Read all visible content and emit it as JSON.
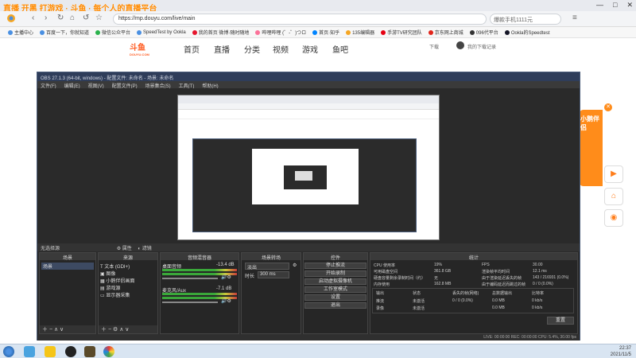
{
  "browser": {
    "tab_title": "直播 开黑 打游戏 · 斗鱼 · 每个人的直播平台",
    "address": "https://mp.douyu.com/live/main",
    "search_placeholder": "爆款手机1111元",
    "bookmarks": [
      "主播中心",
      "百度一下，你就知道",
      "微信公众平台",
      "SpeedTest by Ookla",
      "我的首页 微博·随时随地",
      "哔哩哔哩 (゜-゜)つロ",
      "首页·知乎",
      "135编辑器",
      "手游TV研究团队",
      "京东网上商城",
      "096代平台",
      "Ookla的Speedtest"
    ],
    "window_controls": [
      "—",
      "□",
      "✕"
    ]
  },
  "douyu": {
    "logo": "斗鱼",
    "logo_sub": "DOUYU.COM",
    "nav": [
      "首页",
      "直播",
      "分类",
      "视频",
      "游戏",
      "鱼吧"
    ],
    "download": "下载",
    "user": "我的下载记录"
  },
  "obs": {
    "title": "OBS 27.1.3 (64-bit, windows) - 配置文件: 未命名 - 场景: 未命名",
    "menu": [
      "文件(F)",
      "编辑(E)",
      "视图(V)",
      "配置文件(P)",
      "场景集合(S)",
      "工具(T)",
      "帮助(H)"
    ],
    "source_bar": "无选择源",
    "properties": "属性",
    "filters": "滤镜",
    "docks": {
      "scenes": "场景",
      "sources": "来源",
      "mixer": "音频混音器",
      "transitions": "场景转场",
      "controls": "控件",
      "stats": "统计"
    },
    "scene_items": [
      "场景"
    ],
    "source_items": [
      "文本 (GDI+)",
      "图像",
      "小鹅伴侣画面",
      "游戏源",
      "显示器采集"
    ],
    "mixer": {
      "desktop": "桌面音频",
      "desktop_db": "-13.4 dB",
      "mic": "麦克风/Aux",
      "mic_db": "-7.1 dB"
    },
    "transition": {
      "type": "淡出",
      "duration_label": "时长",
      "duration": "300 ms"
    },
    "controls": [
      "停止推流",
      "开始录制",
      "启动虚拟摄像机",
      "工作室模式",
      "设置",
      "退出"
    ],
    "stats": {
      "rows": [
        [
          "CPU 使用率",
          "19%",
          "FPS",
          "30.00"
        ],
        [
          "可用磁盘空间",
          "361.8 GB",
          "渲染帧平均时间",
          "12.1 ms"
        ],
        [
          "硬盘容量剩余录制时间（约）",
          "无",
          "由于渲染延迟丢失的帧",
          "143 / 216931 (0.0%)"
        ],
        [
          "内存使用",
          "162.8 MB",
          "由于编码延迟而跳过的帧",
          "0 / 0 (0.0%)"
        ]
      ],
      "header": [
        "输出",
        "状态",
        "丢失的帧(网络)",
        "总数据输出",
        "比特率"
      ],
      "outputs": [
        [
          "推流",
          "未激活",
          "0 / 0 (0.0%)",
          "0.0 MB",
          "0 kb/s"
        ],
        [
          "录像",
          "未激活",
          "",
          "0.0 MB",
          "0 kb/s"
        ]
      ],
      "reset": "重置"
    },
    "status": "LIVE: 00:00:00   REC: 00:00:00   CPU: 5.4%, 30.00 fps"
  },
  "side": {
    "banner": "小鹅伴侣",
    "close": "✕"
  },
  "taskbar": {
    "time": "22:37",
    "date": "2021/11/5"
  }
}
